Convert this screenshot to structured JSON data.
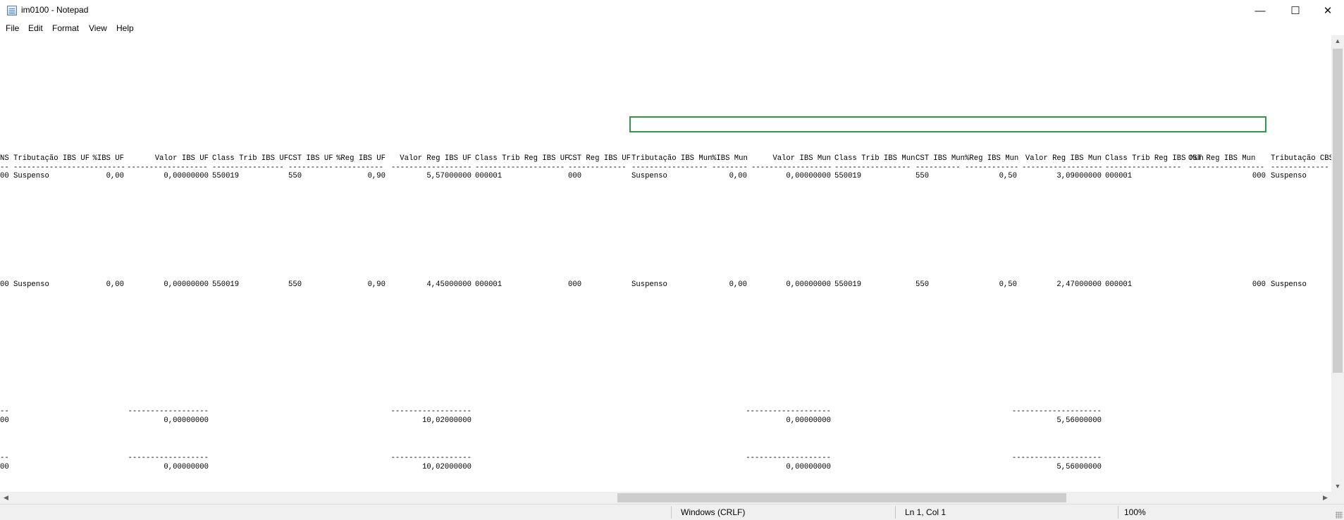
{
  "window": {
    "title": "im0100 - Notepad",
    "icon": "notepad-icon",
    "controls": {
      "minimize": "—",
      "maximize": "☐",
      "close": "✕"
    }
  },
  "menu": [
    {
      "label": "File"
    },
    {
      "label": "Edit"
    },
    {
      "label": "Format"
    },
    {
      "label": "View"
    },
    {
      "label": "Help"
    }
  ],
  "editor": {
    "header": {
      "prefix": "NS",
      "trib_ibs_uf": "Tributação IBS UF",
      "pct_ibs_uf": "%IBS UF",
      "valor_ibs_uf": "Valor IBS UF",
      "class_trib_ibs_uf": "Class Trib IBS UF",
      "cst_ibs_uf": "CST IBS UF",
      "pct_reg_ibs_uf": "%Reg IBS UF",
      "valor_reg_ibs_uf": "Valor Reg IBS UF",
      "class_trib_reg_ibs_uf": "Class Trib Reg IBS UF",
      "cst_reg_ibs_uf": "CST Reg IBS UF",
      "trib_ibs_mun": "Tributação IBS Mun",
      "pct_ibs_mun": "%IBS Mun",
      "valor_ibs_mun": "Valor IBS Mun",
      "class_trib_ibs_mun": "Class Trib IBS Mun",
      "cst_ibs_mun": "CST IBS Mun",
      "pct_reg_ibs_mun": "%Reg IBS Mun",
      "valor_reg_ibs_mun": "Valor Reg IBS Mun",
      "class_trib_reg_ibs_mun": "Class Trib Reg IBS Mun",
      "cst_reg_ibs_mun": "CST Reg IBS Mun",
      "trib_cbs": "Tributação CBS"
    },
    "rows": [
      {
        "prefix": "00",
        "trib_ibs_uf": "Suspenso",
        "pct_ibs_uf": "0,00",
        "valor_ibs_uf": "0,00000000",
        "class_trib_ibs_uf": "550019",
        "cst_ibs_uf": "550",
        "pct_reg_ibs_uf": "0,90",
        "valor_reg_ibs_uf": "5,57000000",
        "class_trib_reg_ibs_uf": "000001",
        "cst_reg_ibs_uf": "000",
        "trib_ibs_mun": "Suspenso",
        "pct_ibs_mun": "0,00",
        "valor_ibs_mun": "0,00000000",
        "class_trib_ibs_mun": "550019",
        "cst_ibs_mun": "550",
        "pct_reg_ibs_mun": "0,50",
        "valor_reg_ibs_mun": "3,09000000",
        "class_trib_reg_ibs_mun": "000001",
        "cst_reg_ibs_mun": "000",
        "trib_cbs": "Suspenso"
      },
      {
        "prefix": "00",
        "trib_ibs_uf": "Suspenso",
        "pct_ibs_uf": "0,00",
        "valor_ibs_uf": "0,00000000",
        "class_trib_ibs_uf": "550019",
        "cst_ibs_uf": "550",
        "pct_reg_ibs_uf": "0,90",
        "valor_reg_ibs_uf": "4,45000000",
        "class_trib_reg_ibs_uf": "000001",
        "cst_reg_ibs_uf": "000",
        "trib_ibs_mun": "Suspenso",
        "pct_ibs_mun": "0,00",
        "valor_ibs_mun": "0,00000000",
        "class_trib_ibs_mun": "550019",
        "cst_ibs_mun": "550",
        "pct_reg_ibs_mun": "0,50",
        "valor_reg_ibs_mun": "2,47000000",
        "class_trib_reg_ibs_mun": "000001",
        "cst_reg_ibs_mun": "000",
        "trib_cbs": "Suspenso"
      }
    ],
    "totals": [
      {
        "prefix": "00",
        "valor_ibs_uf": "0,00000000",
        "valor_reg_ibs_uf": "10,02000000",
        "valor_ibs_mun": "0,00000000",
        "valor_reg_ibs_mun": "5,56000000"
      },
      {
        "prefix": "00",
        "valor_ibs_uf": "0,00000000",
        "valor_reg_ibs_uf": "10,02000000",
        "valor_ibs_mun": "0,00000000",
        "valor_reg_ibs_mun": "5,56000000"
      }
    ],
    "highlight_color": "#2a9d44"
  },
  "statusbar": {
    "line_ending": "Windows (CRLF)",
    "position": "Ln 1, Col 1",
    "zoom": "100%"
  }
}
